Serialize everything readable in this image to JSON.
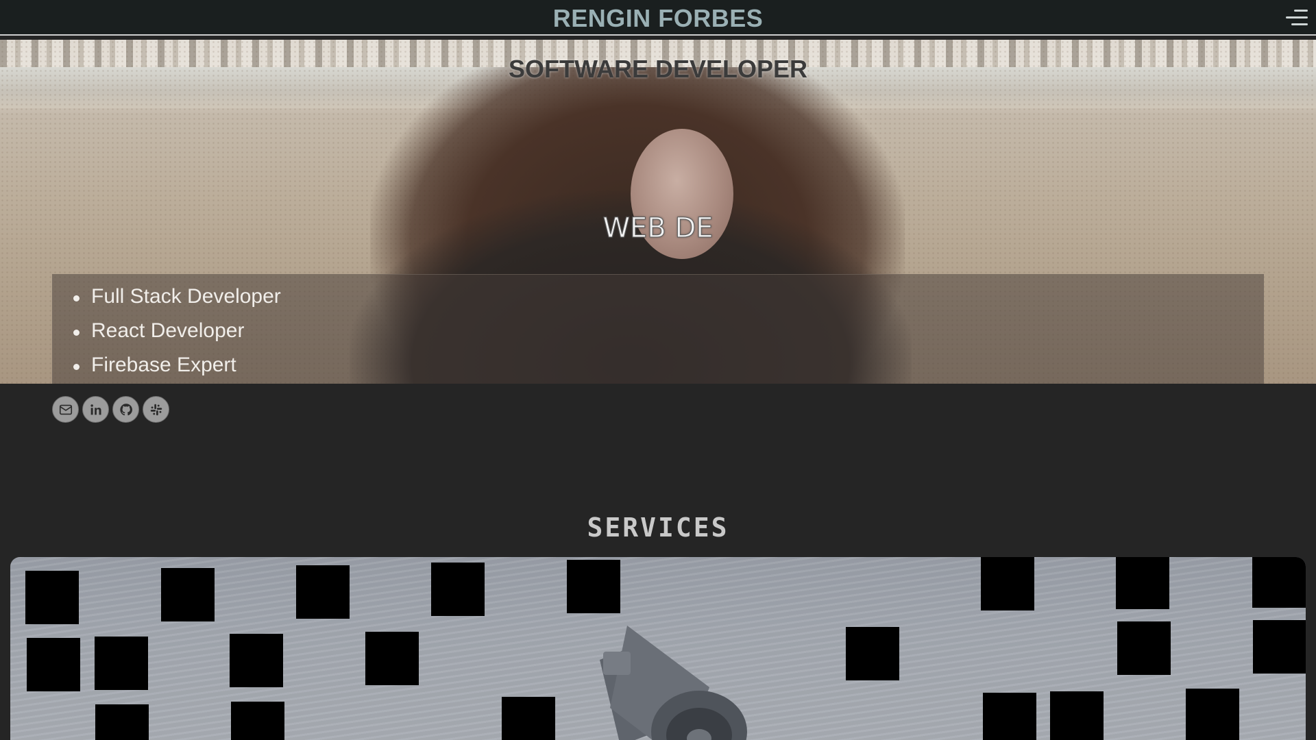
{
  "nav": {
    "brand": "RENGIN FORBES",
    "menu_icon": "hamburger-menu-icon"
  },
  "hero": {
    "title": "SOFTWARE DEVELOPER",
    "typing_text": "WEB DE",
    "skills": [
      "Full Stack Developer",
      "React Developer",
      "Firebase Expert"
    ]
  },
  "social": [
    {
      "name": "email",
      "icon": "mail-icon"
    },
    {
      "name": "linkedin",
      "icon": "linkedin-icon"
    },
    {
      "name": "github",
      "icon": "github-icon"
    },
    {
      "name": "slack",
      "icon": "slack-icon"
    }
  ],
  "services": {
    "title": "SERVICES",
    "image_icon": "megaphone-icon"
  },
  "colors": {
    "nav_bg": "#1a1f1f",
    "brand": "#9ab0b4",
    "page_bg": "#252525",
    "services_title": "#c9c9c9"
  }
}
